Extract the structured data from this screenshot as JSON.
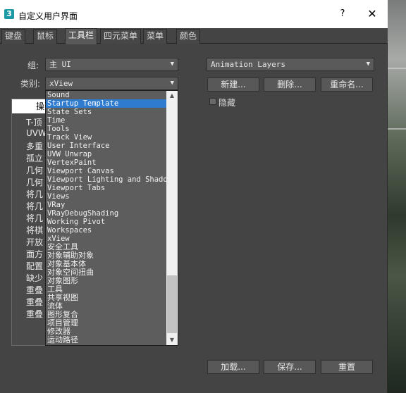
{
  "window": {
    "title": "自定义用户界面",
    "help_label": "?",
    "close_label": "✕"
  },
  "tabs": [
    {
      "label": "键盘"
    },
    {
      "label": "鼠标"
    },
    {
      "label": "工具栏"
    },
    {
      "label": "四元菜单"
    },
    {
      "label": "菜单"
    },
    {
      "label": "颜色"
    }
  ],
  "active_tab": "工具栏",
  "group": {
    "label": "组:",
    "value": "主 UI"
  },
  "category": {
    "label": "类别:",
    "value": "xView"
  },
  "toolbar_select": {
    "value": "Animation Layers"
  },
  "buttons": {
    "new": "新建...",
    "delete": "删除...",
    "rename": "重命名...",
    "load": "加载...",
    "save": "保存...",
    "reset": "重置"
  },
  "hide_checkbox": {
    "label": "隐藏",
    "checked": false
  },
  "action_panel": {
    "header": "操",
    "items": [
      "T-顶",
      "UVW",
      "多重",
      "孤立",
      "几何",
      "几何",
      "将几",
      "将几",
      "将几",
      "将棋",
      "开放",
      "面方",
      "配置",
      "缺少",
      "重叠",
      "重叠",
      "重叠"
    ]
  },
  "category_list": {
    "selected": "Startup Template",
    "items": [
      "Sound",
      "Startup Template",
      "State Sets",
      "Time",
      "Tools",
      "Track View",
      "User Interface",
      "UVW Unwrap",
      "VertexPaint",
      "Viewport Canvas",
      "Viewport Lighting and Shadows",
      "Viewport Tabs",
      "Views",
      "VRay",
      "VRayDebugShading",
      "Working Pivot",
      "Workspaces",
      "xView",
      "安全工具",
      "对象辅助对象",
      "对象基本体",
      "对象空间扭曲",
      "对象图形",
      "工具",
      "共享视图",
      "流体",
      "图形复合",
      "项目管理",
      "修改器",
      "运动路径"
    ]
  },
  "colors": {
    "accent": "#2f7bd0",
    "panel": "#444444",
    "titlebar": "#ffffff"
  },
  "icons": {
    "app": "3ds-max-app-icon",
    "dropdown": "chevron-down-icon"
  }
}
